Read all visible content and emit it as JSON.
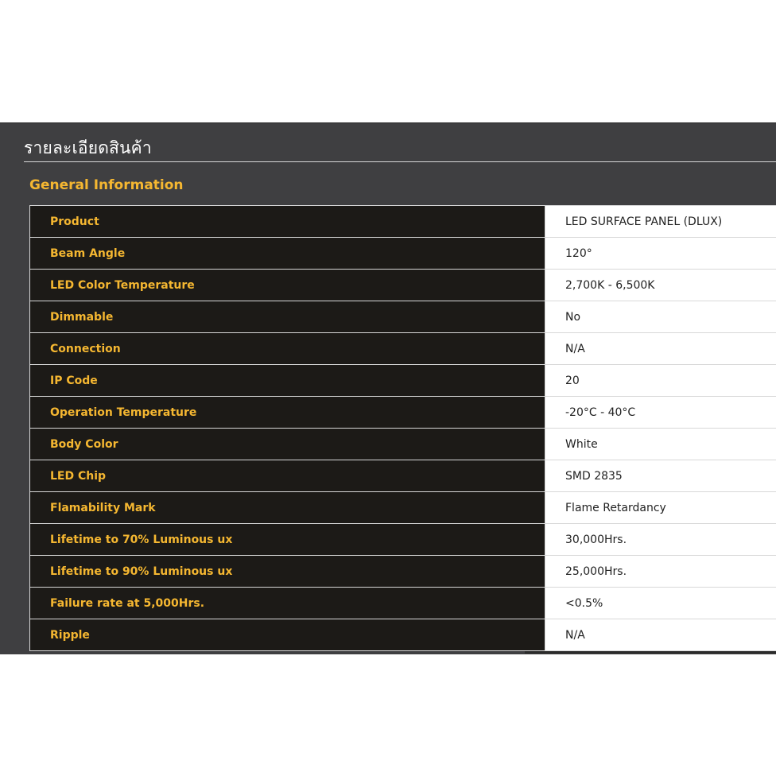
{
  "header": {
    "title": "รายละเอียดสินค้า"
  },
  "section": {
    "title": "General Information"
  },
  "specs": [
    {
      "label": "Product",
      "value": "LED SURFACE PANEL (DLUX)"
    },
    {
      "label": "Beam Angle",
      "value": "120°"
    },
    {
      "label": "LED Color Temperature",
      "value": "2,700K - 6,500K"
    },
    {
      "label": "Dimmable",
      "value": "No"
    },
    {
      "label": "Connection",
      "value": "N/A"
    },
    {
      "label": "IP Code",
      "value": "20"
    },
    {
      "label": "Operation Temperature",
      "value": "-20°C - 40°C"
    },
    {
      "label": "Body Color",
      "value": "White"
    },
    {
      "label": "LED Chip",
      "value": "SMD 2835"
    },
    {
      "label": "Flamability Mark",
      "value": "Flame Retardancy"
    },
    {
      "label": "Lifetime to 70% Luminous ux",
      "value": "30,000Hrs."
    },
    {
      "label": "Lifetime to 90% Luminous ux",
      "value": "25,000Hrs."
    },
    {
      "label": "Failure rate at 5,000Hrs.",
      "value": "<0.5%"
    },
    {
      "label": "Ripple",
      "value": "N/A"
    }
  ],
  "colors": {
    "panel_bg": "#3f3f41",
    "label_cell_bg": "#1c1a17",
    "accent": "#f5b731",
    "value_cell_bg": "#ffffff"
  }
}
